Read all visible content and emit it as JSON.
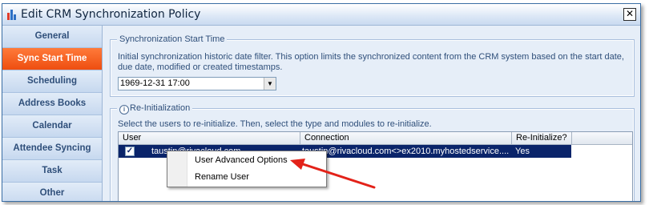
{
  "window": {
    "title": "Edit CRM Synchronization Policy",
    "close_glyph": "✕",
    "icon": "app-icon"
  },
  "sidebar": {
    "items": [
      {
        "label": "General",
        "active": false
      },
      {
        "label": "Sync Start Time",
        "active": true
      },
      {
        "label": "Scheduling",
        "active": false
      },
      {
        "label": "Address Books",
        "active": false
      },
      {
        "label": "Calendar",
        "active": false
      },
      {
        "label": "Attendee Syncing",
        "active": false
      },
      {
        "label": "Task",
        "active": false
      },
      {
        "label": "Other",
        "active": false
      }
    ]
  },
  "sync_start": {
    "legend": "Synchronization Start Time",
    "description_line1": "Initial synchronization historic date filter.  This option limits the synchronized content from the CRM system based on the start date,",
    "description_line2": "due date, modified or created timestamps.",
    "date_value": "1969-12-31 17:00"
  },
  "reinit": {
    "legend": "Re-Initialization",
    "info_icon": "i",
    "description": "Select the users to re-initialize.  Then, select the type and modules to re-initialize.",
    "columns": [
      "User",
      "Connection",
      "Re-Initialize?"
    ],
    "rows": [
      {
        "checked": true,
        "check_glyph": "✓",
        "user": "taustin@rivacloud.com",
        "connection": "taustin@rivacloud.com<>ex2010.myhostedservice....",
        "reinit": "Yes"
      }
    ]
  },
  "context_menu": {
    "items": [
      "User Advanced Options",
      "Rename User"
    ]
  },
  "colors": {
    "accent_active": "#ee4e10",
    "selection": "#0a246a",
    "annotation_arrow": "#e32219"
  }
}
